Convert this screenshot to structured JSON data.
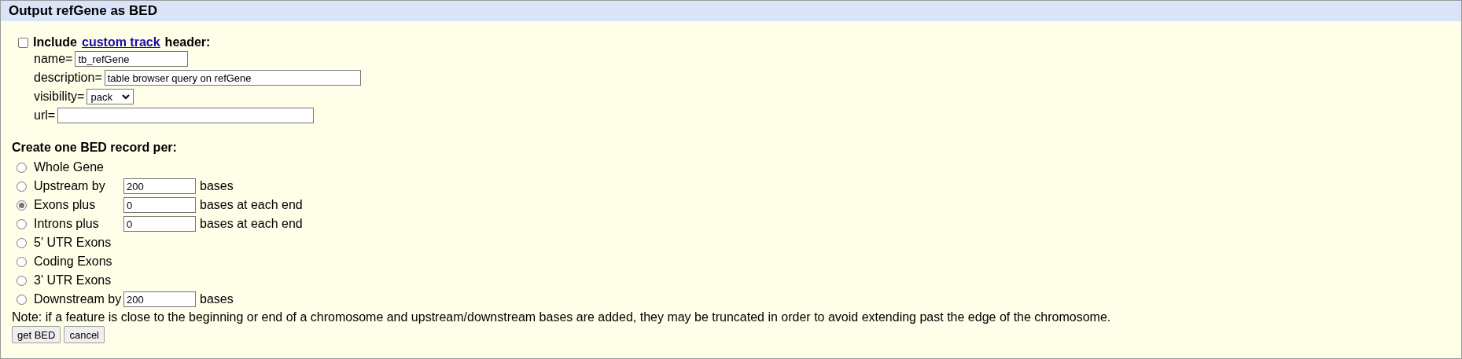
{
  "header": {
    "title": "Output refGene as BED"
  },
  "custom_track": {
    "checked": false,
    "label_before": "Include",
    "link": "custom track",
    "label_after": "header:",
    "fields": [
      {
        "kind": "short_text",
        "label": "name=",
        "value": "tb_refGene"
      },
      {
        "kind": "long_text",
        "label": "description=",
        "value": "table browser query on refGene"
      },
      {
        "kind": "select",
        "label": "visibility=",
        "value": "pack"
      },
      {
        "kind": "long_text",
        "label": "url="
      }
    ]
  },
  "record": {
    "heading": "Create one BED record per:",
    "options": [
      {
        "kind": "plain",
        "label": "Whole Gene",
        "selected": false
      },
      {
        "kind": "input",
        "label": "Upstream by",
        "selected": false,
        "value": "200",
        "suffix": "bases"
      },
      {
        "kind": "input",
        "label": "Exons plus",
        "selected": true,
        "value": "0",
        "suffix": "bases at each end"
      },
      {
        "kind": "input",
        "label": "Introns plus",
        "selected": false,
        "value": "0",
        "suffix": "bases at each end"
      },
      {
        "kind": "plain",
        "label": "5' UTR Exons",
        "selected": false
      },
      {
        "kind": "plain",
        "label": "Coding Exons",
        "selected": false
      },
      {
        "kind": "plain",
        "label": "3' UTR Exons",
        "selected": false
      },
      {
        "kind": "input",
        "label": "Downstream by",
        "selected": false,
        "value": "200",
        "suffix": "bases"
      }
    ]
  },
  "note": "Note: if a feature is close to the beginning or end of a chromosome and upstream/downstream bases are added, they may be truncated in order to avoid extending past the edge of the chromosome.",
  "buttons": [
    "get BED",
    "cancel"
  ]
}
